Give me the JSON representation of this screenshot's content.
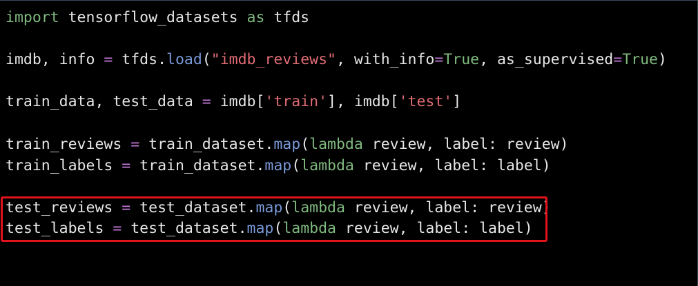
{
  "code": {
    "line1": {
      "kw_import": "import",
      "module": " tensorflow_datasets ",
      "kw_as": "as",
      "alias": " tfds"
    },
    "line2": {
      "lhs": "imdb, info ",
      "eq": "=",
      "obj": " tfds.",
      "fn": "load",
      "open": "(",
      "str": "\"imdb_reviews\"",
      "arg1": ", with_info",
      "eq1": "=",
      "val1": "True",
      "arg2": ", as_supervised",
      "eq2": "=",
      "val2": "True",
      "close": ")"
    },
    "line3": {
      "lhs": "train_data, test_data ",
      "eq": "=",
      "obj1": " imdb[",
      "str1": "'train'",
      "mid": "], imdb[",
      "str2": "'test'",
      "close": "]"
    },
    "line4": {
      "lhs": "train_reviews ",
      "eq": "=",
      "obj": " train_dataset.",
      "fn": "map",
      "open": "(",
      "kw": "lambda",
      "rest": " review, label: review)"
    },
    "line5": {
      "lhs": "train_labels ",
      "eq": "=",
      "obj": " train_dataset.",
      "fn": "map",
      "open": "(",
      "kw": "lambda",
      "rest": " review, label: label)"
    },
    "line6": {
      "lhs": "test_reviews ",
      "eq": "=",
      "obj": " test_dataset.",
      "fn": "map",
      "open": "(",
      "kw": "lambda",
      "rest": " review, label: review)"
    },
    "line7": {
      "lhs": "test_labels ",
      "eq": "=",
      "obj": " test_dataset.",
      "fn": "map",
      "open": "(",
      "kw": "lambda",
      "rest": " review, label: label)"
    }
  },
  "colors": {
    "background": "#000000",
    "keyword": "#7fb97f",
    "operator": "#c678dd",
    "function": "#7a9ad9",
    "string": "#e06c75",
    "highlight_border": "#e3131b"
  }
}
